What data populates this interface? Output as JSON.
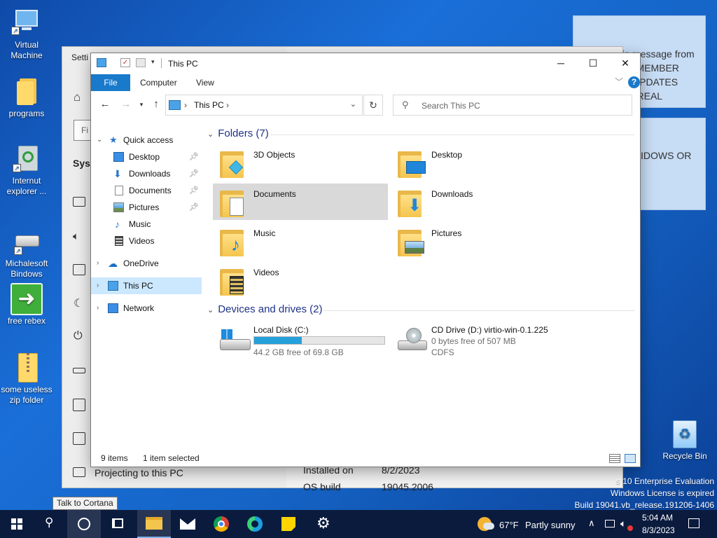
{
  "desktop": {
    "icons": [
      {
        "label": "Virtual Machine"
      },
      {
        "label": "programs"
      },
      {
        "label": "Internut explorer ..."
      },
      {
        "label": "Michalesoft Bindows"
      },
      {
        "label": "free rebex"
      },
      {
        "label": "some useless zip folder"
      }
    ],
    "recycle_bin": "Recycle Bin",
    "watermark": [
      "s 10 Enterprise Evaluation",
      "Windows License is expired",
      "Build 19041.vb_release.191206-1406"
    ]
  },
  "notes": {
    "top_lines": [
      "is message from",
      "REMEMBER",
      "R UPDATES",
      "AL REAL"
    ],
    "bottom_lines": [
      "IDOWS OR"
    ]
  },
  "settings": {
    "title": "Setti",
    "search_partial": "Fi",
    "section": "Syst",
    "projecting": "Projecting to this PC",
    "installed_on_label": "Installed on",
    "installed_on_value": "8/2/2023",
    "os_build_label": "OS build",
    "os_build_value": "19045.2006"
  },
  "explorer": {
    "title": "This PC",
    "ribbon_tabs": [
      "File",
      "Computer",
      "View"
    ],
    "address_path": "This PC",
    "search_placeholder": "Search This PC",
    "nav": [
      {
        "label": "Quick access"
      },
      {
        "label": "Desktop"
      },
      {
        "label": "Downloads"
      },
      {
        "label": "Documents"
      },
      {
        "label": "Pictures"
      },
      {
        "label": "Music"
      },
      {
        "label": "Videos"
      },
      {
        "label": "OneDrive"
      },
      {
        "label": "This PC"
      },
      {
        "label": "Network"
      }
    ],
    "folders_header": "Folders (7)",
    "folders": [
      {
        "name": "3D Objects"
      },
      {
        "name": "Desktop"
      },
      {
        "name": "Documents"
      },
      {
        "name": "Downloads"
      },
      {
        "name": "Music"
      },
      {
        "name": "Pictures"
      },
      {
        "name": "Videos"
      }
    ],
    "devices_header": "Devices and drives (2)",
    "drives": [
      {
        "name": "Local Disk (C:)",
        "free_text": "44.2 GB free of 69.8 GB",
        "used_fraction": 0.367
      },
      {
        "name": "CD Drive (D:) virtio-win-0.1.225",
        "free_text": "0 bytes free of 507 MB",
        "fs": "CDFS"
      }
    ],
    "status_items": "9 items",
    "status_selected": "1 item selected"
  },
  "tooltip": "Talk to Cortana",
  "taskbar": {
    "weather_temp": "67°F",
    "weather_desc": "Partly sunny",
    "time": "5:04 AM",
    "date": "8/3/2023"
  },
  "colors": {
    "accent": "#1979ca",
    "selection": "#cce8ff",
    "progress": "#26a0da",
    "group_header": "#1e3287"
  }
}
